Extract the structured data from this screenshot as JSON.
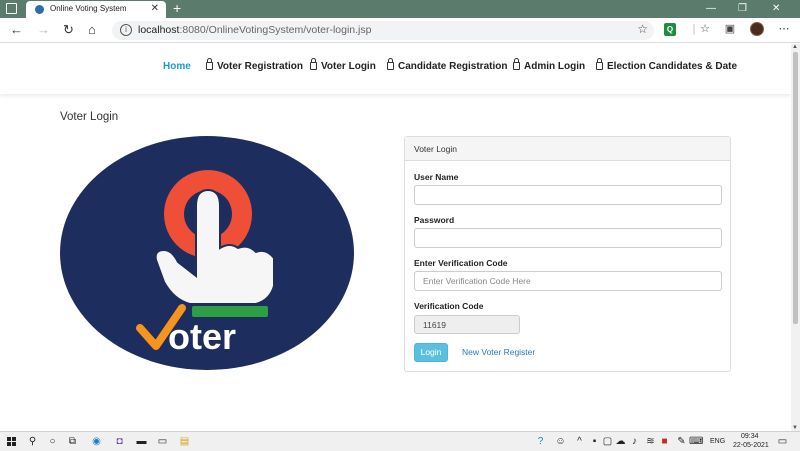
{
  "browser": {
    "tab_title": "Online Voting System",
    "new_tab": "+",
    "url_host": "localhost",
    "url_path": ":8080/OnlineVotingSystem/voter-login.jsp"
  },
  "nav": {
    "home": "Home",
    "voter_registration": "Voter Registration",
    "voter_login": "Voter Login",
    "candidate_registration": "Candidate Registration",
    "admin_login": "Admin Login",
    "election_candidates": "Election Candidates & Date"
  },
  "page": {
    "heading": "Voter Login",
    "logo_text": "oter"
  },
  "form": {
    "panel_title": "Voter Login",
    "username_label": "User Name",
    "username_value": "",
    "password_label": "Password",
    "password_value": "",
    "verify_label": "Enter Verification Code",
    "verify_placeholder": "Enter Verification Code Here",
    "code_label": "Verification Code",
    "code_value": "11619",
    "login_button": "Login",
    "register_link": "New Voter Register"
  },
  "taskbar": {
    "lang": "ENG",
    "time": "09:34",
    "date": "22-05-2021"
  },
  "colors": {
    "nav_active": "#1a9bd7",
    "login_button": "#5bc0de",
    "logo_circle": "#1d2d5e",
    "logo_red": "#ef4f37",
    "logo_green": "#2e9e44",
    "logo_check": "#f7941d"
  }
}
